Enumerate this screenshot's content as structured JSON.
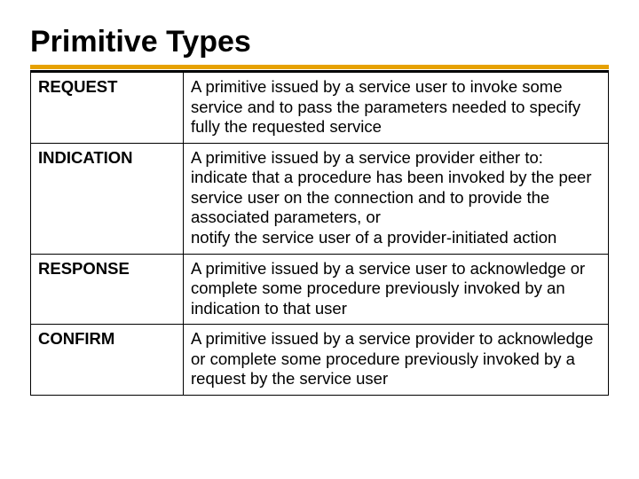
{
  "title": "Primitive Types",
  "rows": [
    {
      "term": "REQUEST",
      "desc": "A primitive issued by a service user to invoke some service and to pass the parameters needed to specify fully the requested service"
    },
    {
      "term": "INDICATION",
      "desc_lines": [
        "A primitive issued by a service provider either to:",
        "indicate that a procedure has been invoked by the peer service user on the connection and to provide the associated parameters, or",
        "notify the service user of a provider-initiated action"
      ]
    },
    {
      "term": "RESPONSE",
      "desc": "A primitive issued by a service user to acknowledge or complete some procedure previously invoked by an indication to that user"
    },
    {
      "term": "CONFIRM",
      "desc": "A primitive issued by a service provider to acknowledge or complete some procedure previously invoked by a request by the service user"
    }
  ]
}
